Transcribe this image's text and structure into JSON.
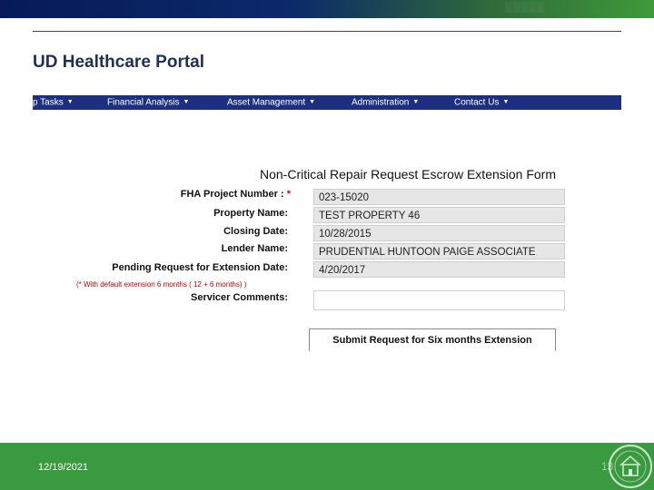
{
  "portal": {
    "title": "UD Healthcare Portal"
  },
  "nav": {
    "items": [
      {
        "label": "p Tasks"
      },
      {
        "label": "Financial Analysis"
      },
      {
        "label": "Asset Management"
      },
      {
        "label": "Administration"
      },
      {
        "label": "Contact Us"
      }
    ]
  },
  "form": {
    "title": "Non-Critical Repair Request Escrow Extension Form",
    "required_mark": "*",
    "fields": [
      {
        "label": "FHA Project Number :",
        "value": "023-15020"
      },
      {
        "label": "Property Name:",
        "value": "TEST PROPERTY 46"
      },
      {
        "label": "Closing Date:",
        "value": "10/28/2015"
      },
      {
        "label": "Lender Name:",
        "value": "PRUDENTIAL HUNTOON PAIGE ASSOCIATE"
      },
      {
        "label": "Pending Request for Extension Date:",
        "value": "4/20/2017"
      },
      {
        "label": "Servicer Comments:",
        "value": ""
      }
    ],
    "note": "(* With default extension 6 months ( 12 + 6 months) )",
    "submit_label": "Submit Request for Six months Extension"
  },
  "footer": {
    "date": "12/19/2021",
    "page_number": "13"
  },
  "colors": {
    "navbar": "#1d2f80",
    "footer": "#3a9a40",
    "title": "#1f2f55"
  }
}
